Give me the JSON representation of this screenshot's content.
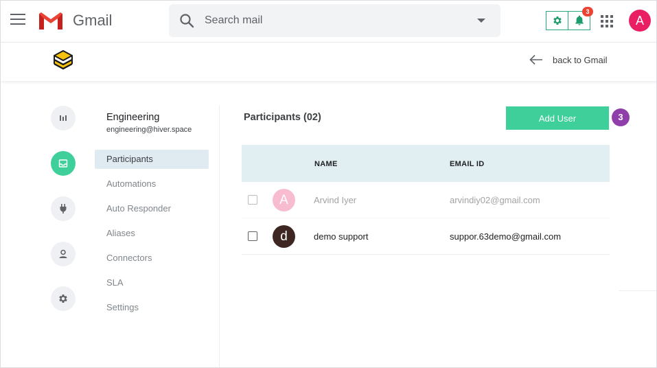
{
  "gmail": {
    "app_name": "Gmail",
    "search_placeholder": "Search mail",
    "notification_count": "3",
    "account_initial": "A"
  },
  "hiver_header": {
    "back_label": "back to Gmail"
  },
  "group": {
    "name": "Engineering",
    "email": "engineering@hiver.space"
  },
  "rail_icons": [
    "analytics-icon",
    "shared-inbox-icon",
    "plug-icon",
    "user-icon",
    "settings-icon"
  ],
  "nav": {
    "items": [
      {
        "label": "Participants",
        "active": true
      },
      {
        "label": "Automations"
      },
      {
        "label": "Auto Responder"
      },
      {
        "label": "Aliases"
      },
      {
        "label": "Connectors"
      },
      {
        "label": "SLA"
      },
      {
        "label": "Settings"
      }
    ]
  },
  "participants": {
    "title": "Participants (02)",
    "add_button": "Add User",
    "step_badge": "3",
    "columns": [
      "NAME",
      "EMAIL ID"
    ],
    "rows": [
      {
        "initial": "A",
        "name": "Arvind Iyer",
        "email": "arvindiy02@gmail.com",
        "avatar_color": "#f06292",
        "disabled": true
      },
      {
        "initial": "d",
        "name": "demo support",
        "email": "suppor.63demo@gmail.com",
        "avatar_color": "#3e2723",
        "disabled": false
      }
    ]
  },
  "colors": {
    "accent_green": "#3ecf9a",
    "step_purple": "#8e3fa9",
    "table_header": "#e1eef2",
    "nav_active": "#dfeaf1"
  }
}
